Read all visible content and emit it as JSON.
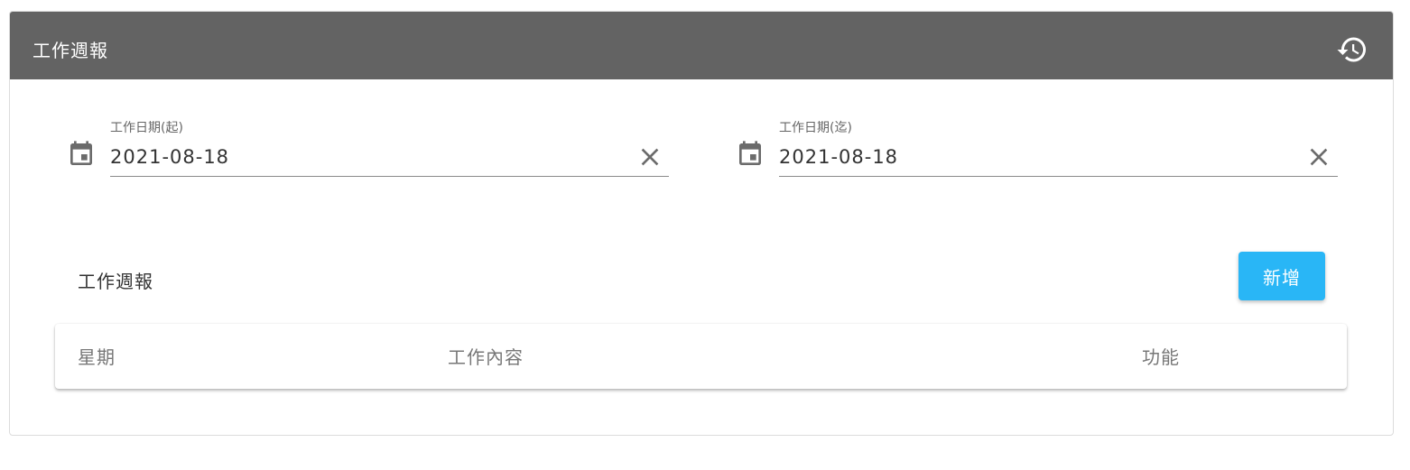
{
  "header": {
    "title": "工作週報",
    "history_icon": "history-icon",
    "background": "#636363"
  },
  "filters": {
    "start": {
      "label": "工作日期(起)",
      "value": "2021-08-18",
      "icon": "calendar-icon",
      "clear_icon": "close-icon"
    },
    "end": {
      "label": "工作日期(迄)",
      "value": "2021-08-18",
      "icon": "calendar-icon",
      "clear_icon": "close-icon"
    }
  },
  "section": {
    "title": "工作週報",
    "add_label": "新增",
    "add_color": "#29b6f6"
  },
  "table": {
    "columns": [
      "星期",
      "工作內容",
      "功能"
    ],
    "rows": []
  }
}
